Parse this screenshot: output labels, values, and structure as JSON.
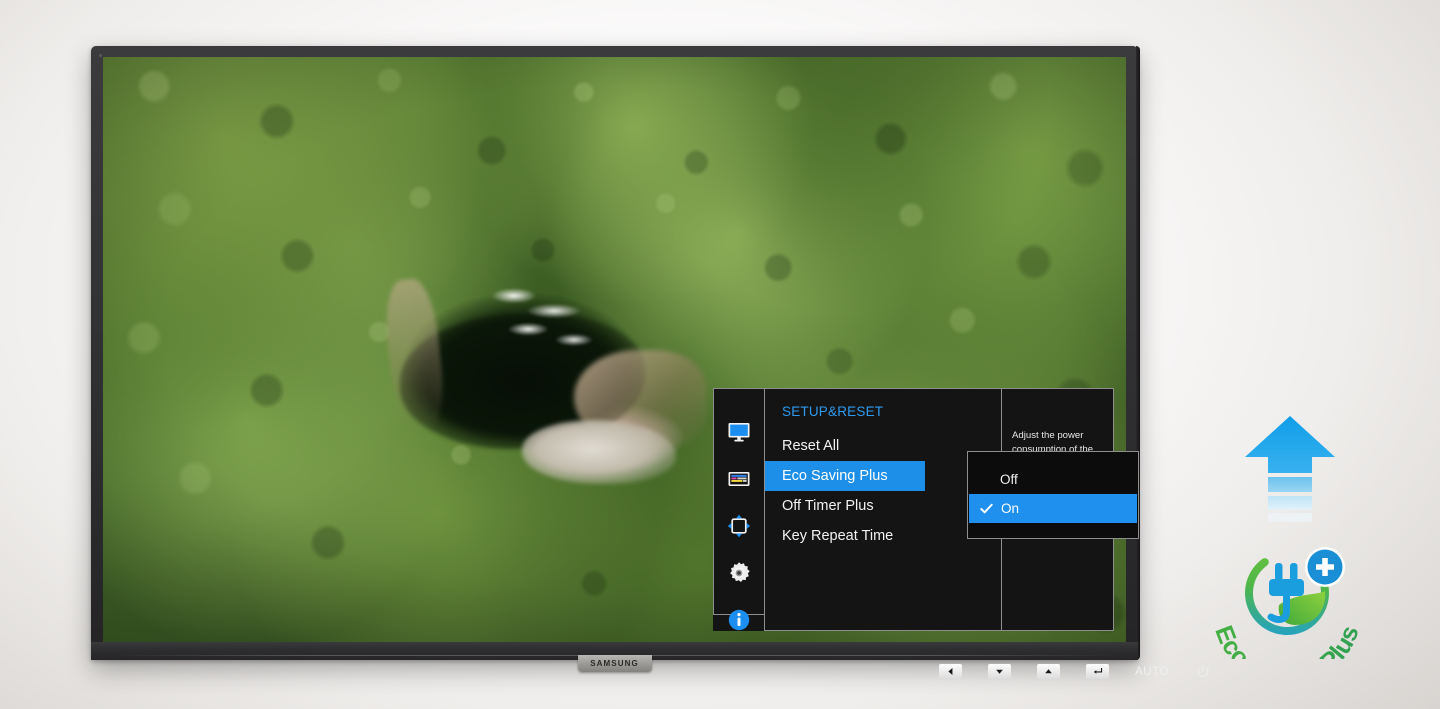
{
  "product": {
    "brand": "SAMSUNG"
  },
  "osd": {
    "title": "SETUP&RESET",
    "icons": [
      {
        "name": "display-icon",
        "label": "Picture"
      },
      {
        "name": "color-bars-icon",
        "label": "Color"
      },
      {
        "name": "screen-adjust-icon",
        "label": "Display"
      },
      {
        "name": "gear-icon",
        "label": "System"
      },
      {
        "name": "info-icon",
        "label": "Information"
      }
    ],
    "menu_items": [
      {
        "label": "Reset All",
        "selected": false
      },
      {
        "label": "Eco Saving Plus",
        "selected": true
      },
      {
        "label": "Off Timer Plus",
        "selected": false
      },
      {
        "label": "Key Repeat Time",
        "selected": false
      }
    ],
    "dropdown": {
      "options": [
        {
          "label": "Off",
          "checked": false,
          "highlighted": false
        },
        {
          "label": "On",
          "checked": true,
          "highlighted": true
        }
      ]
    },
    "description": "Adjust the power consumption of the product to save energy automatically",
    "colors": {
      "title_blue": "#2e9bf0",
      "highlight_blue": "#1e8fe8",
      "dropdown_blue": "#2090ef",
      "panel_bg": "#141414",
      "border": "#8e8e8e"
    }
  },
  "hardware_keys": [
    {
      "name": "back-key",
      "glyph": "left-triangle",
      "label": ""
    },
    {
      "name": "down-key",
      "glyph": "down-triangle",
      "label": ""
    },
    {
      "name": "up-key",
      "glyph": "up-triangle",
      "label": ""
    },
    {
      "name": "enter-key",
      "glyph": "enter-arrow",
      "label": ""
    },
    {
      "name": "auto-key",
      "glyph": "text",
      "label": "AUTO"
    },
    {
      "name": "power-key",
      "glyph": "power-symbol",
      "label": ""
    }
  ],
  "eco_badge": {
    "logo_text": "Eco Saving Plus",
    "arrow_segments": 3,
    "colors": {
      "arrow_top": "#1ba0e8",
      "arrow_bottom": "#7fc8ee",
      "leaf_green": "#5cb531",
      "plug_blue": "#1b9ede",
      "ring_gradient_start": "#4fb648",
      "ring_gradient_end": "#1b9ede"
    }
  },
  "scene": {
    "description": "Aerial photo of dense tropical rainforest canopy with a dark river lagoon and sandbank at center"
  }
}
